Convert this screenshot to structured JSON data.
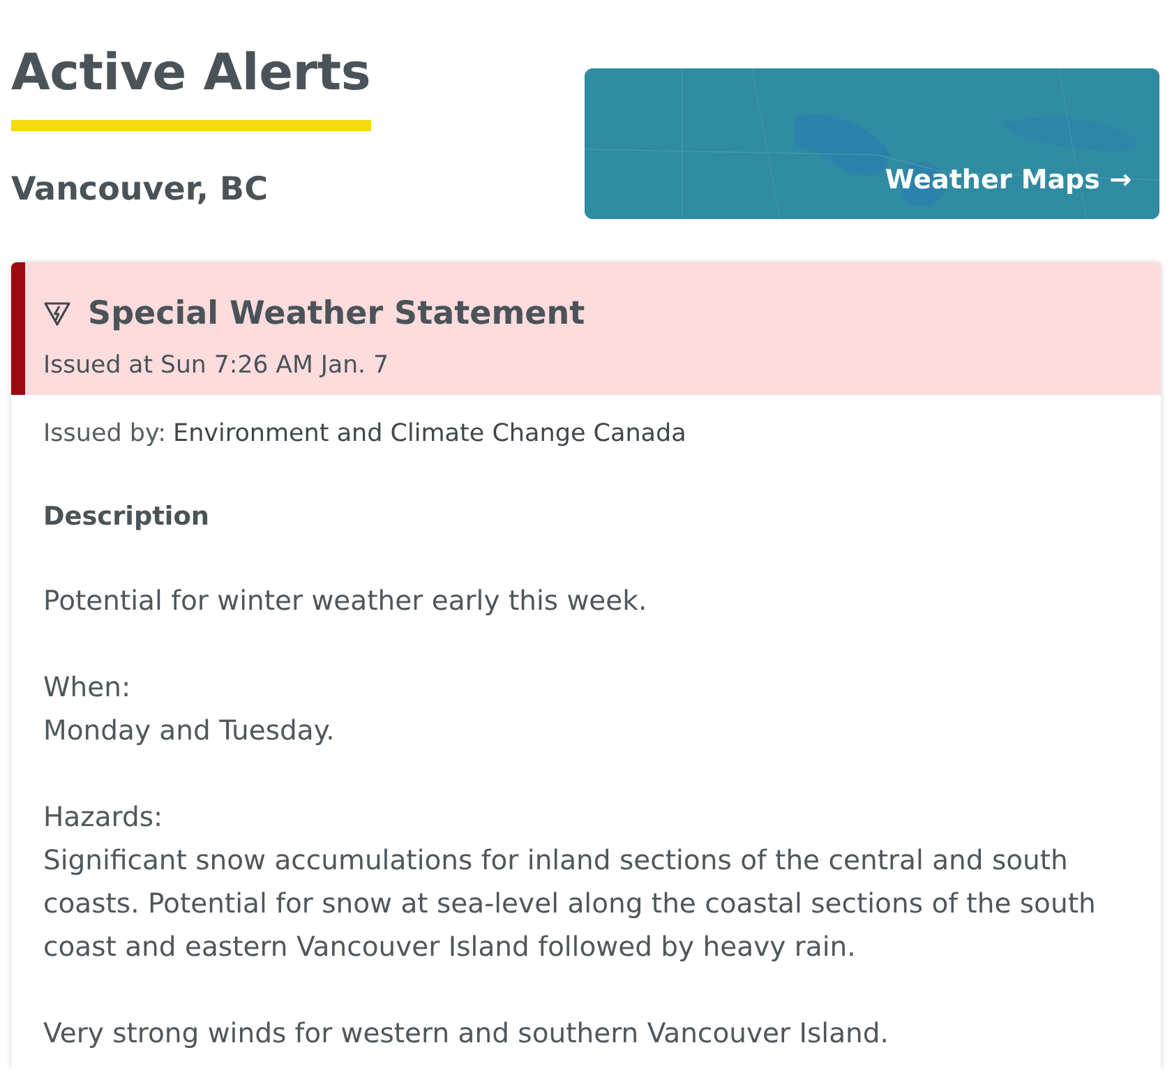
{
  "page": {
    "title": "Active Alerts",
    "location": "Vancouver, BC"
  },
  "maps_link": {
    "label": "Weather Maps →"
  },
  "alerts": [
    {
      "title": "Special Weather Statement",
      "issued_at": "Issued at Sun 7:26 AM Jan. 7",
      "issued_by": {
        "label": "Issued by:",
        "value": "Environment and Climate Change Canada"
      },
      "description": {
        "heading": "Description",
        "paragraphs": [
          [
            "Potential for winter weather early this week."
          ],
          [
            "When:",
            "Monday and Tuesday."
          ],
          [
            "Hazards:",
            "Significant snow accumulations for inland sections of the central and south coasts. Potential for snow at sea-level along the coastal sections of the south coast and eastern Vancouver Island followed by heavy rain."
          ],
          [
            "Very strong winds for western and southern Vancouver Island."
          ]
        ]
      }
    }
  ]
}
